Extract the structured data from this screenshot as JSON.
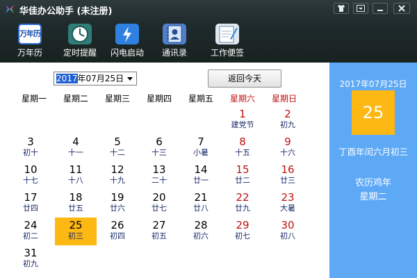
{
  "app": {
    "title": "华佳办公助手 (未注册)",
    "window_buttons": [
      "skin",
      "menu",
      "minimize",
      "close"
    ]
  },
  "toolbar": [
    {
      "label": "万年历",
      "icon": "calendar-icon",
      "icon_text": "万年历"
    },
    {
      "label": "定时提醒",
      "icon": "clock-icon"
    },
    {
      "label": "闪电启动",
      "icon": "lightning-icon"
    },
    {
      "label": "通讯录",
      "icon": "contacts-book-icon"
    },
    {
      "label": "工作便签",
      "icon": "notepad-icon"
    }
  ],
  "calendar": {
    "date_select_year": "2017",
    "date_select_rest": "年07月25日",
    "today_button": "返回今天",
    "weekdays": [
      "星期一",
      "星期二",
      "星期三",
      "星期四",
      "星期五",
      "星期六",
      "星期日"
    ],
    "weeks": [
      [
        null,
        null,
        null,
        null,
        null,
        {
          "day": "1",
          "lunar": "建党节"
        },
        {
          "day": "2",
          "lunar": "初九"
        }
      ],
      [
        {
          "day": "3",
          "lunar": "初十"
        },
        {
          "day": "4",
          "lunar": "十一"
        },
        {
          "day": "5",
          "lunar": "十二"
        },
        {
          "day": "6",
          "lunar": "十三"
        },
        {
          "day": "7",
          "lunar": "小暑"
        },
        {
          "day": "8",
          "lunar": "十五"
        },
        {
          "day": "9",
          "lunar": "十六"
        }
      ],
      [
        {
          "day": "10",
          "lunar": "十七"
        },
        {
          "day": "11",
          "lunar": "十八"
        },
        {
          "day": "12",
          "lunar": "十九"
        },
        {
          "day": "13",
          "lunar": "二十"
        },
        {
          "day": "14",
          "lunar": "廿一"
        },
        {
          "day": "15",
          "lunar": "廿二"
        },
        {
          "day": "16",
          "lunar": "廿三"
        }
      ],
      [
        {
          "day": "17",
          "lunar": "廿四"
        },
        {
          "day": "18",
          "lunar": "廿五"
        },
        {
          "day": "19",
          "lunar": "廿六"
        },
        {
          "day": "20",
          "lunar": "廿七"
        },
        {
          "day": "21",
          "lunar": "廿八"
        },
        {
          "day": "22",
          "lunar": "廿九"
        },
        {
          "day": "23",
          "lunar": "大暑"
        }
      ],
      [
        {
          "day": "24",
          "lunar": "初二"
        },
        {
          "day": "25",
          "lunar": "初三",
          "selected": true
        },
        {
          "day": "26",
          "lunar": "初四"
        },
        {
          "day": "27",
          "lunar": "初五"
        },
        {
          "day": "28",
          "lunar": "初六"
        },
        {
          "day": "29",
          "lunar": "初七"
        },
        {
          "day": "30",
          "lunar": "初八"
        }
      ],
      [
        {
          "day": "31",
          "lunar": "初九"
        },
        null,
        null,
        null,
        null,
        null,
        null
      ]
    ]
  },
  "side_panel": {
    "date": "2017年07月25日",
    "day": "25",
    "lunar": "丁酉年闰六月初三",
    "zodiac_year": "农历鸡年",
    "weekday": "星期二"
  },
  "colors": {
    "header_bg": "#1f2a2c",
    "panel_bg": "#5ea9f5",
    "highlight": "#fdb813",
    "weekend_red": "#c01010",
    "lunar_text": "#1a2a6a"
  }
}
